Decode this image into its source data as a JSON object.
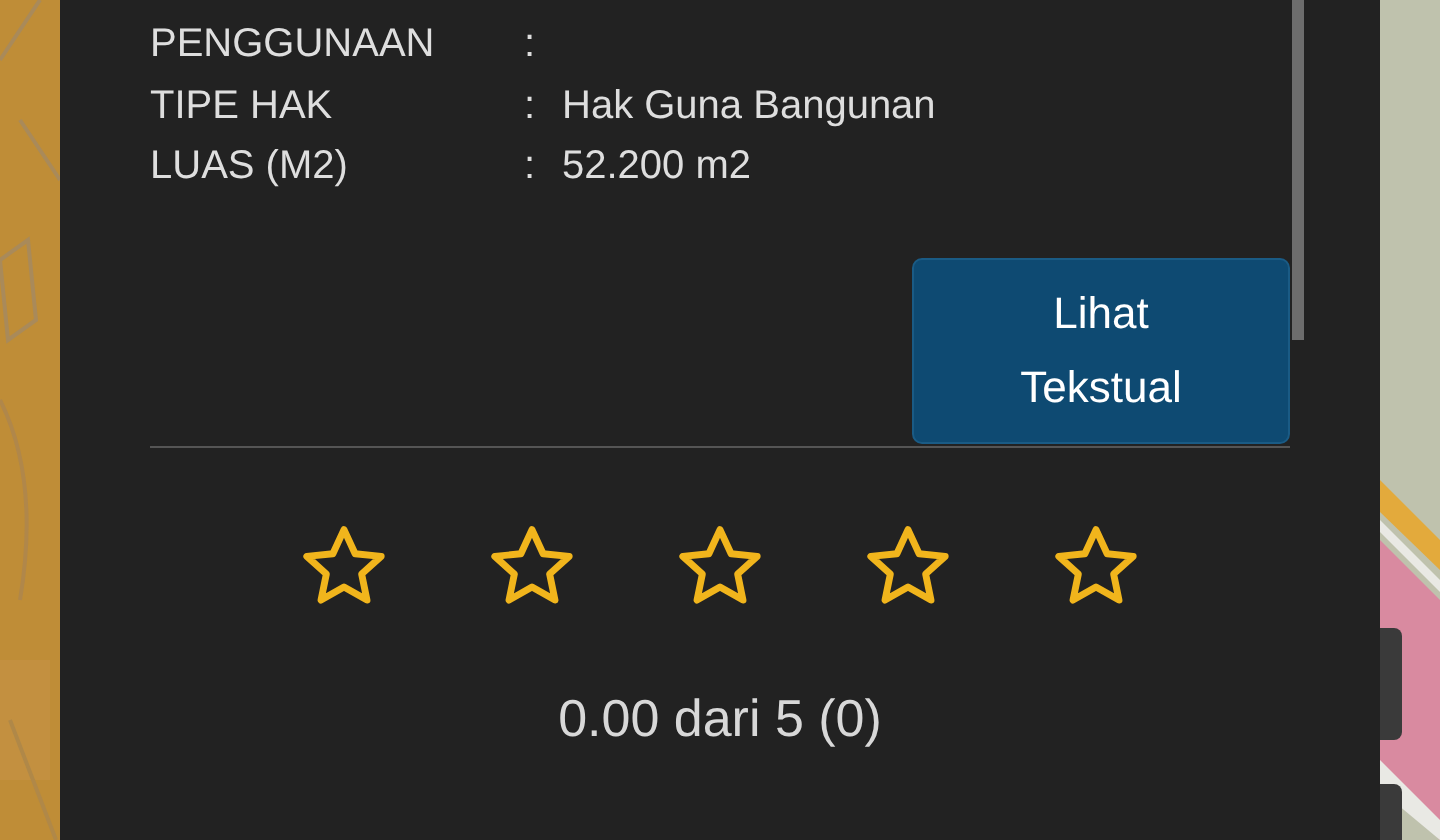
{
  "details": [
    {
      "label": "PENGGUNAAN",
      "separator": ":"
    },
    {
      "label": "TIPE HAK",
      "separator": ":",
      "value": "Hak Guna Bangunan"
    },
    {
      "label": "LUAS (M2)",
      "separator": ":",
      "value": "52.200 m2"
    }
  ],
  "button": {
    "label": "Lihat Tekstual"
  },
  "rating": {
    "stars": 0,
    "summary": "0.00 dari 5 (0)"
  }
}
